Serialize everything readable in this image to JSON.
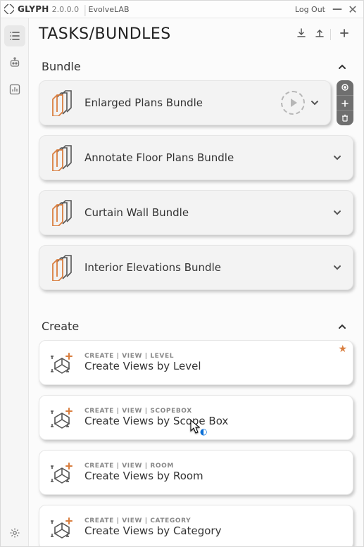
{
  "titlebar": {
    "app_name": "GLYPH",
    "version": "2.0.0.0",
    "org": "EvolveLAB",
    "logout": "Log Out",
    "logo_icon": "glyph-logo"
  },
  "sidebar": {
    "items": [
      {
        "name": "tasks-icon",
        "active": true
      },
      {
        "name": "robot-icon",
        "active": false
      },
      {
        "name": "chart-icon",
        "active": false
      }
    ],
    "settings_icon": "settings-icon"
  },
  "header": {
    "title": "TASKS/BUNDLES",
    "download_icon": "download-icon",
    "upload_icon": "upload-icon",
    "add_icon": "add-icon"
  },
  "sections": {
    "bundle": {
      "title": "Bundle",
      "expanded": true,
      "items": [
        {
          "label": "Enlarged Plans Bundle",
          "run_visible": true,
          "sidepod": true
        },
        {
          "label": "Annotate Floor Plans Bundle",
          "run_visible": false,
          "sidepod": false
        },
        {
          "label": "Curtain Wall Bundle",
          "run_visible": false,
          "sidepod": false
        },
        {
          "label": "Interior Elevations Bundle",
          "run_visible": false,
          "sidepod": false
        }
      ],
      "sidepod_icons": [
        "link-icon",
        "plus-icon",
        "trash-icon"
      ]
    },
    "create": {
      "title": "Create",
      "expanded": true,
      "items": [
        {
          "crumbs": "CREATE | VIEW | LEVEL",
          "label": "Create Views by Level",
          "starred": true
        },
        {
          "crumbs": "CREATE | VIEW | SCOPEBOX",
          "label": "Create Views by Scope Box",
          "starred": false,
          "cursor": true
        },
        {
          "crumbs": "CREATE | VIEW | ROOM",
          "label": "Create Views by Room",
          "starred": false
        },
        {
          "crumbs": "CREATE | VIEW | CATEGORY",
          "label": "Create Views by Category",
          "starred": false
        }
      ]
    }
  }
}
